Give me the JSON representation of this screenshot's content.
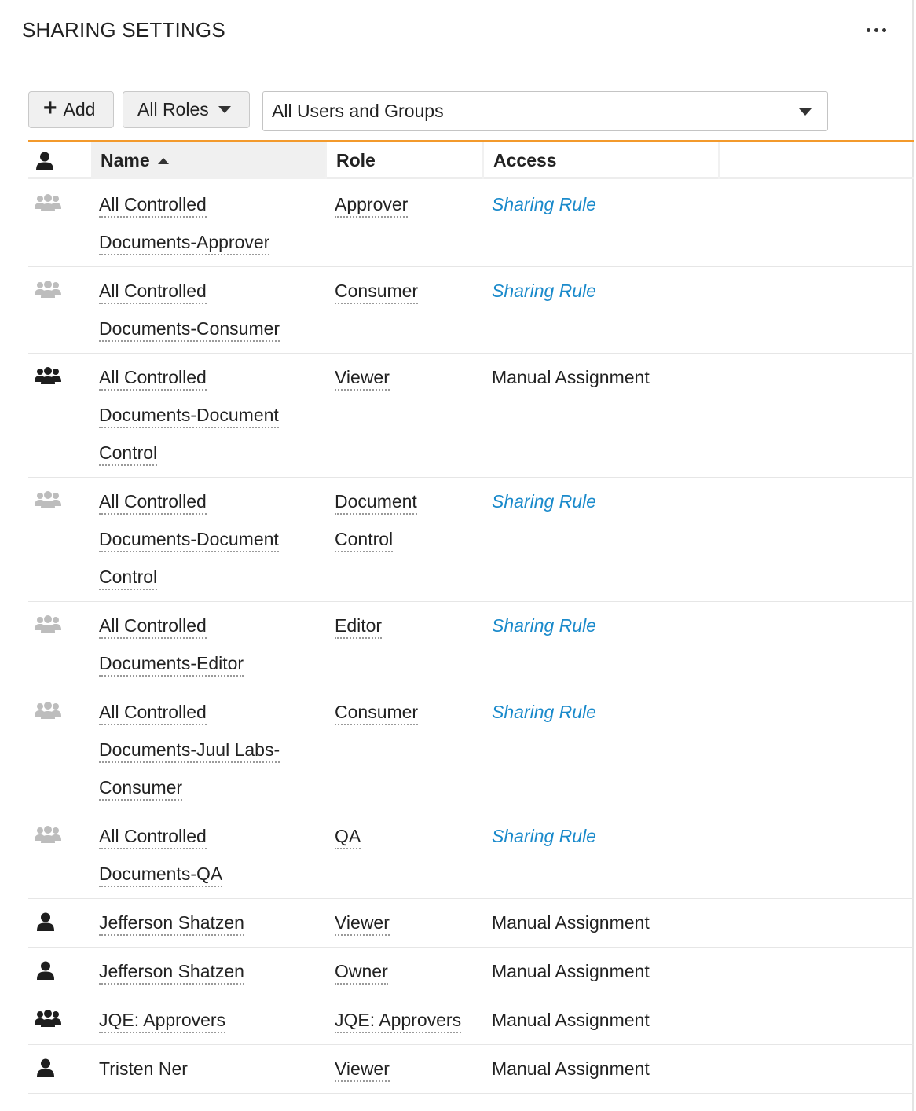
{
  "header": {
    "title": "SHARING SETTINGS",
    "more_icon": "ellipsis-icon"
  },
  "toolbar": {
    "add_label": "Add",
    "add_icon": "plus-icon",
    "roles_label": "All Roles",
    "users_select_value": "All Users and Groups"
  },
  "table": {
    "columns": {
      "icon": "person-icon",
      "name": "Name",
      "role": "Role",
      "access": "Access"
    },
    "sort": {
      "column": "Name",
      "direction": "ascending"
    },
    "rows": [
      {
        "type": "group",
        "active": false,
        "name_lines": [
          "All Controlled",
          "Documents-Approver"
        ],
        "role_lines": [
          "Approver"
        ],
        "access": "Sharing Rule",
        "access_kind": "rule"
      },
      {
        "type": "group",
        "active": false,
        "name_lines": [
          "All Controlled",
          "Documents-Consumer"
        ],
        "role_lines": [
          "Consumer"
        ],
        "access": "Sharing Rule",
        "access_kind": "rule"
      },
      {
        "type": "group",
        "active": true,
        "name_lines": [
          "All Controlled",
          "Documents-Document",
          "Control"
        ],
        "role_lines": [
          "Viewer"
        ],
        "access": "Manual Assignment",
        "access_kind": "manual"
      },
      {
        "type": "group",
        "active": false,
        "name_lines": [
          "All Controlled",
          "Documents-Document",
          "Control"
        ],
        "role_lines": [
          "Document",
          "Control"
        ],
        "access": "Sharing Rule",
        "access_kind": "rule"
      },
      {
        "type": "group",
        "active": false,
        "name_lines": [
          "All Controlled",
          "Documents-Editor"
        ],
        "role_lines": [
          "Editor"
        ],
        "access": "Sharing Rule",
        "access_kind": "rule"
      },
      {
        "type": "group",
        "active": false,
        "name_lines": [
          "All Controlled",
          "Documents-Juul Labs-",
          "Consumer"
        ],
        "role_lines": [
          "Consumer"
        ],
        "access": "Sharing Rule",
        "access_kind": "rule"
      },
      {
        "type": "group",
        "active": false,
        "name_lines": [
          "All Controlled",
          "Documents-QA"
        ],
        "role_lines": [
          "QA"
        ],
        "access": "Sharing Rule",
        "access_kind": "rule"
      },
      {
        "type": "user",
        "active": true,
        "name_lines": [
          "Jefferson Shatzen"
        ],
        "role_lines": [
          "Viewer"
        ],
        "access": "Manual Assignment",
        "access_kind": "manual",
        "name_link": true
      },
      {
        "type": "user",
        "active": true,
        "name_lines": [
          "Jefferson Shatzen"
        ],
        "role_lines": [
          "Owner"
        ],
        "access": "Manual Assignment",
        "access_kind": "manual",
        "name_link": true
      },
      {
        "type": "group",
        "active": true,
        "name_lines": [
          "JQE: Approvers"
        ],
        "role_lines": [
          "JQE: Approvers"
        ],
        "access": "Manual Assignment",
        "access_kind": "manual",
        "name_link": true
      },
      {
        "type": "user",
        "active": true,
        "name_lines": [
          "Tristen Ner"
        ],
        "role_lines": [
          "Viewer"
        ],
        "access": "Manual Assignment",
        "access_kind": "manual",
        "name_link": false
      }
    ]
  }
}
